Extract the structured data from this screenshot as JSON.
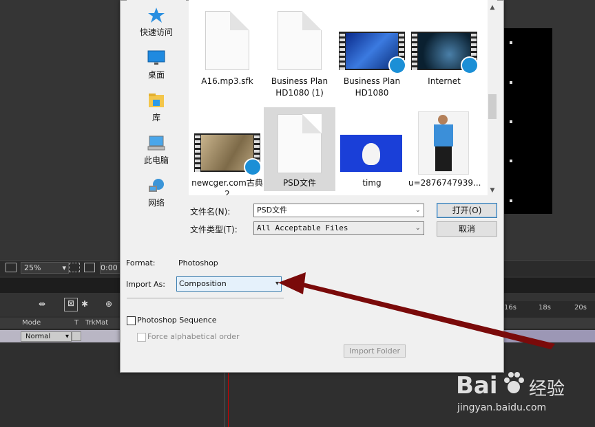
{
  "ae": {
    "zoom": "25%",
    "time": "0:00",
    "columns": {
      "mode": "Mode",
      "t": "T",
      "trkmat": "TrkMat"
    },
    "layer_mode": "Normal",
    "time_ticks": [
      "16s",
      "18s",
      "20s"
    ]
  },
  "dialog": {
    "places": [
      {
        "label": "快速访问",
        "icon": "star-icon"
      },
      {
        "label": "桌面",
        "icon": "desktop-icon"
      },
      {
        "label": "库",
        "icon": "library-icon"
      },
      {
        "label": "此电脑",
        "icon": "computer-icon"
      },
      {
        "label": "网络",
        "icon": "network-icon"
      }
    ],
    "files": [
      {
        "name_line1": "A16.mp3.sfk",
        "name_line2": "",
        "kind": "doc"
      },
      {
        "name_line1": "Business Plan",
        "name_line2": "HD1080 (1)",
        "kind": "doc"
      },
      {
        "name_line1": "Business Plan",
        "name_line2": "HD1080",
        "kind": "video"
      },
      {
        "name_line1": "Internet",
        "name_line2": "",
        "kind": "video"
      },
      {
        "name_line1": "newcger.com古典",
        "name_line2": "2",
        "kind": "video"
      },
      {
        "name_line1": "PSD文件",
        "name_line2": "",
        "kind": "doc"
      },
      {
        "name_line1": "timg",
        "name_line2": "",
        "kind": "image"
      },
      {
        "name_line1": "u=2876747939...",
        "name_line2": "",
        "kind": "image"
      }
    ],
    "filename_label": "文件名(N):",
    "filename_value": "PSD文件",
    "filetype_label": "文件类型(T):",
    "filetype_value": "All Acceptable Files",
    "open_label": "打开(O)",
    "cancel_label": "取消",
    "format_label": "Format:",
    "format_value": "Photoshop",
    "import_as_label": "Import As:",
    "import_as_value": "Composition",
    "sequence_label": "Photoshop Sequence",
    "force_alpha_label": "Force alphabetical order",
    "import_folder_label": "Import Folder"
  },
  "watermark": {
    "brand": "Bai",
    "brand2": "经验",
    "url": "jingyan.baidu.com"
  },
  "colors": {
    "annotation_arrow": "#7a0a0a",
    "accent_blue": "#1b8fd6"
  }
}
